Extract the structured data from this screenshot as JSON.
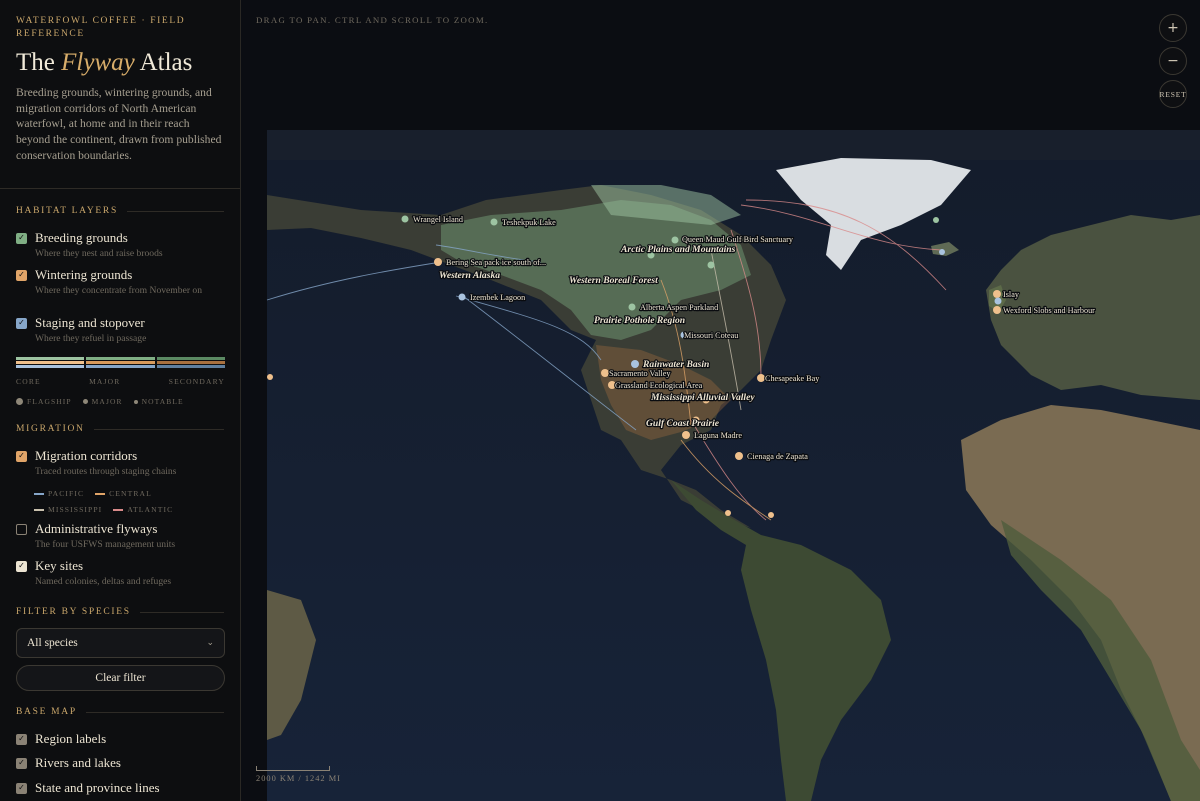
{
  "sidebar": {
    "kicker": "WATERFOWL COFFEE · FIELD REFERENCE",
    "title_pre": "The",
    "title_em": "Flyway",
    "title_post": "Atlas",
    "intro": "Breeding grounds, wintering grounds, and migration corridors of North American waterfowl, at home and in their reach beyond the continent, drawn from published conservation boundaries.",
    "habitat_heading": "HABITAT LAYERS",
    "habitat_layers": [
      {
        "label": "Breeding grounds",
        "sub": "Where they nest and raise broods",
        "checked": true,
        "color": "#7fae84"
      },
      {
        "label": "Wintering grounds",
        "sub": "Where they concentrate from November on",
        "checked": true,
        "color": "#e0a468"
      },
      {
        "label": "Staging and stopover",
        "sub": "Where they refuel in passage",
        "checked": true,
        "color": "#86a6c9"
      }
    ],
    "legend_tiers": [
      "CORE",
      "MAJOR",
      "SECONDARY"
    ],
    "legend_colors": {
      "core": [
        "#9dc4a2",
        "#efc08c",
        "#a9c3df"
      ],
      "major": [
        "#7fae84",
        "#d89a5c",
        "#86a6c9"
      ],
      "secondary": [
        "#5b8a63",
        "#a8703f",
        "#5f7f9f"
      ]
    },
    "site_sizes": [
      "FLAGSHIP",
      "MAJOR",
      "NOTABLE"
    ],
    "migration_heading": "MIGRATION",
    "migration_layers": [
      {
        "label": "Migration corridors",
        "sub": "Traced routes through staging chains",
        "checked": true,
        "color": "#e0a468"
      },
      {
        "label": "Administrative flyways",
        "sub": "The four USFWS management units",
        "checked": false,
        "color": ""
      },
      {
        "label": "Key sites",
        "sub": "Named colonies, deltas and refuges",
        "checked": true,
        "color": "#ece4d2"
      }
    ],
    "flyways": [
      {
        "name": "PACIFIC",
        "color": "#86a6c9"
      },
      {
        "name": "CENTRAL",
        "color": "#e0a468"
      },
      {
        "name": "MISSISSIPPI",
        "color": "#c9c0ad"
      },
      {
        "name": "ATLANTIC",
        "color": "#d98a8a"
      }
    ],
    "filter_heading": "FILTER BY SPECIES",
    "species_select": "All species",
    "clear_filter": "Clear filter",
    "basemap_heading": "BASE MAP",
    "basemap_layers": [
      {
        "label": "Region labels",
        "checked": true,
        "color": "#8a8275"
      },
      {
        "label": "Rivers and lakes",
        "checked": true,
        "color": "#8a8275"
      },
      {
        "label": "State and province lines",
        "checked": true,
        "color": "#8a8275"
      }
    ]
  },
  "map": {
    "hint": "DRAG TO PAN. CTRL AND SCROLL TO ZOOM.",
    "zoom_in": "+",
    "zoom_out": "−",
    "reset": "RESET",
    "scale": "2000 KM / 1242 MI",
    "region_labels": [
      "Arctic Plains and Mountains",
      "Western Boreal Forest",
      "Western Alaska",
      "Prairie Pothole Region",
      "Rainwater Basin",
      "Mississippi Alluvial Valley",
      "Gulf Coast Prairie"
    ],
    "site_labels": [
      "Wrangel Island",
      "Teshekpuk Lake",
      "Queen Maud Gulf Bird Sanctuary",
      "Bering Sea pack ice south of...",
      "Izembek Lagoon",
      "Alberta Aspen Parkland",
      "Missouri Coteau",
      "Sacramento Valley",
      "Grassland Ecological Area",
      "Chesapeake Bay",
      "Laguna Madre",
      "Cienaga de Zapata",
      "Islay",
      "Wexford Slobs and Harbour"
    ]
  }
}
